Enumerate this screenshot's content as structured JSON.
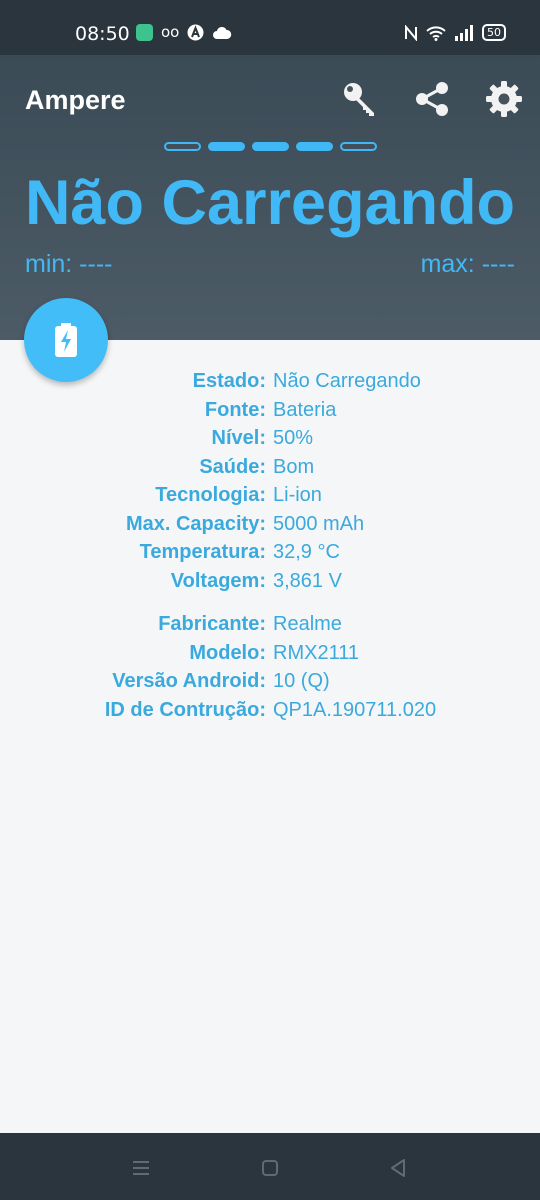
{
  "status_bar": {
    "time": "08:50",
    "battery_level": "50",
    "icons": [
      "app-notification-icon",
      "voicemail-icon",
      "a-icon",
      "cloud-icon",
      "nfc-icon",
      "wifi-icon",
      "signal-icon",
      "battery-icon"
    ]
  },
  "header": {
    "title": "Ampere",
    "status_text": "Não Carregando",
    "min_text": "min: ----",
    "max_text": "max: ----",
    "page_dots": [
      false,
      true,
      true,
      true,
      false
    ],
    "actions": [
      "key-icon",
      "share-icon",
      "gear-icon"
    ]
  },
  "colors": {
    "accent": "#41b9f6",
    "header_bg": "#44535e",
    "system_bar": "#2b353d",
    "text_blue": "#3aa9de"
  },
  "battery_info": [
    {
      "label": "Estado:",
      "value": "Não Carregando"
    },
    {
      "label": "Fonte:",
      "value": "Bateria"
    },
    {
      "label": "Nível:",
      "value": "50%"
    },
    {
      "label": "Saúde:",
      "value": "Bom"
    },
    {
      "label": "Tecnologia:",
      "value": "Li-ion"
    },
    {
      "label": "Max. Capacity:",
      "value": "5000 mAh"
    },
    {
      "label": "Temperatura:",
      "value": "32,9 °C"
    },
    {
      "label": "Voltagem:",
      "value": "3,861 V"
    }
  ],
  "device_info": [
    {
      "label": "Fabricante:",
      "value": "Realme"
    },
    {
      "label": "Modelo:",
      "value": "RMX2111"
    },
    {
      "label": "Versão Android:",
      "value": "10 (Q)"
    },
    {
      "label": "ID de Contrução:",
      "value": "QP1A.190711.020"
    }
  ]
}
